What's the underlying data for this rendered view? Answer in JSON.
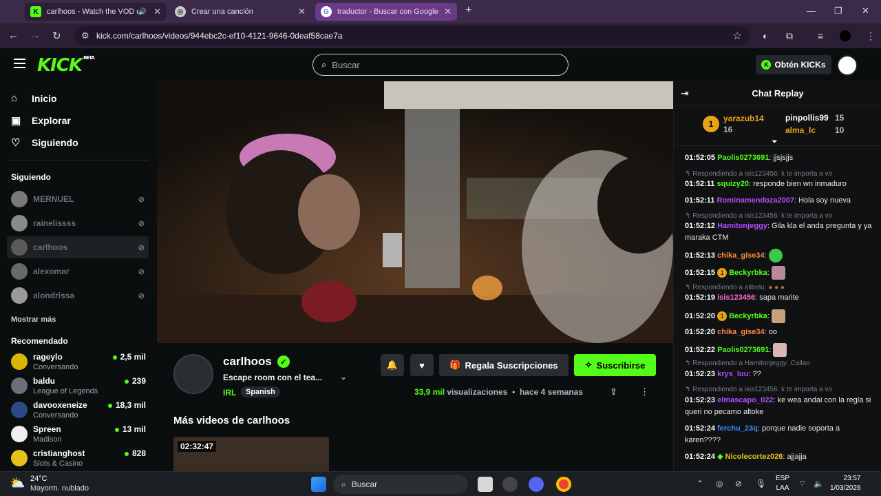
{
  "browser": {
    "tabs": [
      {
        "title": "carlhoos - Watch the VOD e",
        "active": false
      },
      {
        "title": "Crear una canción",
        "active": false
      },
      {
        "title": "traductor - Buscar con Google",
        "active": true
      }
    ],
    "url": "kick.com/carlhoos/videos/944ebc2c-ef10-4121-9646-0deaf58cae7a"
  },
  "header": {
    "logo": "KICK",
    "logo_badge": "BETA",
    "search_placeholder": "Buscar",
    "kicks_button": "Obtén KICKs"
  },
  "sidebar": {
    "nav": [
      {
        "label": "Inicio",
        "icon": "home-icon"
      },
      {
        "label": "Explorar",
        "icon": "explore-icon"
      },
      {
        "label": "Siguiendo",
        "icon": "heart-icon"
      }
    ],
    "following_title": "Siguiendo",
    "following": [
      {
        "name": "MERNUEL"
      },
      {
        "name": "rainelissss"
      },
      {
        "name": "carlhoos"
      },
      {
        "name": "alexomar"
      },
      {
        "name": "alondrissa"
      }
    ],
    "show_more": "Mostrar más",
    "recommended_title": "Recomendado",
    "recommended": [
      {
        "name": "rageylo",
        "category": "Conversando",
        "viewers": "2,5 mil",
        "avatar_color": "#d9b400"
      },
      {
        "name": "baldu",
        "category": "League of Legends",
        "viewers": "239",
        "avatar_color": "#6a6f7a"
      },
      {
        "name": "davooxeneize",
        "category": "Conversando",
        "viewers": "18,3 mil",
        "avatar_color": "#2a4a88"
      },
      {
        "name": "Spreen",
        "category": "Madison",
        "viewers": "13 mil",
        "avatar_color": "#f0f0f0"
      },
      {
        "name": "cristianghost",
        "category": "Slots & Casino",
        "viewers": "828",
        "avatar_color": "#e8c21a"
      }
    ]
  },
  "channel": {
    "name": "carlhoos",
    "title": "Escape room con el tea...",
    "category": "IRL",
    "tag": "Spanish",
    "gift_label": "Regala Suscripciones",
    "subscribe_label": "Suscribirse",
    "views": "33,9 mil",
    "views_label": "visualizaciones",
    "separator": "•",
    "age": "hace 4 semanas",
    "more_videos_title": "Más videos de carlhoos",
    "thumb_duration": "02:32:47"
  },
  "chat": {
    "title": "Chat Replay",
    "leaderboard": [
      {
        "rank": "1",
        "name": "yarazub14",
        "count": "16",
        "color": "#e8a317"
      },
      {
        "name": "pinpollis99",
        "count": "15",
        "color": "#ffffff"
      },
      {
        "name": "alma_lc",
        "count": "10",
        "color": "#e8a317"
      }
    ],
    "messages": [
      {
        "ts": "01:52:05",
        "user": "Paolis0273691",
        "color": "#53fc18",
        "text": "jjsjsjjs"
      },
      {
        "reply": "Respondiendo a isis123456: k te importa a vo"
      },
      {
        "ts": "01:52:11",
        "user": "squizy20",
        "color": "#53fc18",
        "text": "responde bien wn inmaduro"
      },
      {
        "ts": "01:52:11",
        "user": "Rominamendoza2007",
        "color": "#b44bff",
        "text": "Hola soy nueva"
      },
      {
        "reply": "Respondiendo a isis123456: k te importa a vo"
      },
      {
        "ts": "01:52:12",
        "user": "Hamitonjeggy",
        "color": "#b44bff",
        "text": "Gila kla el anda pregunta y ya maraka CTM"
      },
      {
        "ts": "01:52:13",
        "user": "chika_gise34",
        "color": "#ff8a3d",
        "text": ""
      },
      {
        "ts": "01:52:15",
        "user": "Beckyrbka",
        "color": "#53fc18",
        "text": ""
      },
      {
        "reply": "Respondiendo a alibelu:"
      },
      {
        "ts": "01:52:19",
        "user": "isis123456",
        "color": "#ff6ad5",
        "text": "sapa marite"
      },
      {
        "ts": "01:52:20",
        "user": "Beckyrbka",
        "color": "#53fc18",
        "text": ""
      },
      {
        "ts": "01:52:20",
        "user": "chika_gise34",
        "color": "#ff8a3d",
        "text": "oo"
      },
      {
        "ts": "01:52:22",
        "user": "Paolis0273691",
        "color": "#53fc18",
        "text": ""
      },
      {
        "reply": "Respondiendo a Hamitonjeggy: Callao"
      },
      {
        "ts": "01:52:23",
        "user": "krys_luu",
        "color": "#b44bff",
        "text": "??"
      },
      {
        "reply": "Respondiendo a isis123456: k te importa a vo"
      },
      {
        "ts": "01:52:23",
        "user": "elmascapo_022",
        "color": "#b44bff",
        "text": "ke wea andai con la regla si queri no pecamo altoke"
      },
      {
        "ts": "01:52:24",
        "user": "ferchu_23q",
        "color": "#3d8bff",
        "text": "porque nadie soporta a karen????"
      },
      {
        "ts": "01:52:24",
        "user": "Nicolecortez026",
        "color": "#e8c21a",
        "text": "ajjajja"
      }
    ]
  },
  "taskbar": {
    "temp": "24°C",
    "weather": "Mayorm. nublado",
    "search": "Buscar",
    "lang1": "ESP",
    "lang2": "LAA",
    "time": "23:57",
    "date": "1/03/2026"
  },
  "colors": {
    "accent": "#53fc18",
    "bg": "#0b0e0f",
    "tab_bar": "#3b2a4a"
  }
}
